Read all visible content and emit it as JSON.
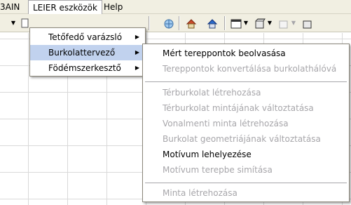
{
  "menubar": {
    "items": [
      {
        "label": "3AIN"
      },
      {
        "label": "LEIER eszközök"
      },
      {
        "label": "Help"
      }
    ]
  },
  "leier_menu": {
    "items": [
      {
        "label": "Tetőfedő varázsló",
        "submenu": true,
        "selected": false
      },
      {
        "label": "Burkolattervező",
        "submenu": true,
        "selected": true
      },
      {
        "label": "Födémszerkesztő",
        "submenu": true,
        "selected": false
      }
    ]
  },
  "submenu": {
    "items": [
      {
        "label": "Mért tereppontok beolvasása",
        "enabled": true
      },
      {
        "label": "Tereppontok konvertálása burkolathálóvá",
        "enabled": false
      },
      {
        "label": "Térburkolat létrehozása",
        "enabled": false
      },
      {
        "label": "Térburkolat mintájának változtatása",
        "enabled": false
      },
      {
        "label": "Vonalmenti minta létrehozása",
        "enabled": false
      },
      {
        "label": "Burkolat geometriájának változtatása",
        "enabled": false
      },
      {
        "label": "Motívum lehelyezése",
        "enabled": true
      },
      {
        "label": "Motívum terepbe simítása",
        "enabled": false
      },
      {
        "label": "Minta létrehozása",
        "enabled": false
      }
    ]
  },
  "icons": {
    "arrow": "submenu-arrow",
    "dropdown": "dropdown-arrow"
  },
  "colors": {
    "menubar": "#f1efe2",
    "selection": "#c1d2ee",
    "disabled_text": "#a7a6aa"
  }
}
